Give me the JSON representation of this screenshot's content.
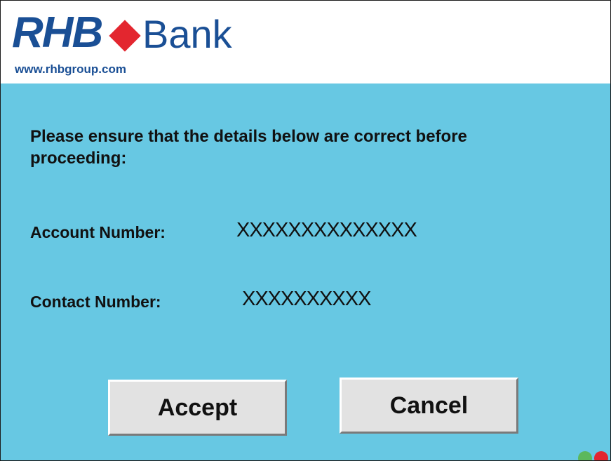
{
  "brand": {
    "name_part1": "RHB",
    "name_part2": "Bank",
    "website": "www.rhbgroup.com",
    "colors": {
      "primary_blue": "#1a4f95",
      "diamond_red": "#e3262f",
      "panel_background": "#67c8e3",
      "button_background": "#e2e2e2"
    }
  },
  "confirmation": {
    "instruction": "Please ensure that the details below are correct before proceeding:",
    "fields": [
      {
        "label": "Account Number:",
        "value": "XXXXXXXXXXXXXX"
      },
      {
        "label": "Contact Number:",
        "value": "XXXXXXXXXX"
      }
    ]
  },
  "actions": {
    "accept_label": "Accept",
    "cancel_label": "Cancel"
  },
  "status_indicators": [
    {
      "name": "green-indicator",
      "color": "#5cb85c"
    },
    {
      "name": "red-indicator",
      "color": "#e3262f"
    }
  ]
}
